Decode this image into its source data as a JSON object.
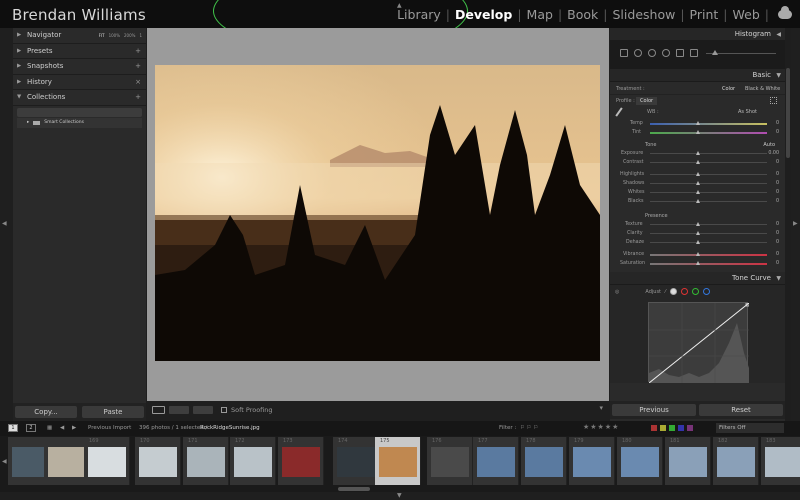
{
  "identity": "Brendan Williams",
  "modules": [
    {
      "label": "Library",
      "active": false
    },
    {
      "label": "Develop",
      "active": true
    },
    {
      "label": "Map",
      "active": false
    },
    {
      "label": "Book",
      "active": false
    },
    {
      "label": "Slideshow",
      "active": false
    },
    {
      "label": "Print",
      "active": false
    },
    {
      "label": "Web",
      "active": false
    }
  ],
  "left_panel": {
    "navigator": {
      "label": "Navigator",
      "zoom": [
        "FIT",
        "100%",
        "200%",
        "1"
      ]
    },
    "presets": {
      "label": "Presets",
      "action": "+"
    },
    "snapshots": {
      "label": "Snapshots",
      "action": "+"
    },
    "history": {
      "label": "History",
      "action": "×"
    },
    "collections": {
      "label": "Collections",
      "action": "+",
      "smart": "Smart Collections"
    },
    "copy_label": "Copy...",
    "paste_label": "Paste"
  },
  "toolbar": {
    "soft_proofing": "Soft Proofing"
  },
  "right_panel": {
    "histogram_label": "Histogram",
    "basic_label": "Basic",
    "treatment": {
      "label": "Treatment :",
      "color": "Color",
      "bw": "Black & White"
    },
    "profile": {
      "label": "Profile :",
      "value": "Color"
    },
    "wb": {
      "label": "WB :",
      "value": "As Shot"
    },
    "temp": {
      "label": "Temp",
      "value": "0"
    },
    "tint": {
      "label": "Tint",
      "value": "0"
    },
    "tone": {
      "label": "Tone",
      "auto": "Auto"
    },
    "tone_sliders": [
      {
        "label": "Exposure",
        "value": "0.00"
      },
      {
        "label": "Contrast",
        "value": "0"
      },
      {
        "label": "Highlights",
        "value": "0"
      },
      {
        "label": "Shadows",
        "value": "0"
      },
      {
        "label": "Whites",
        "value": "0"
      },
      {
        "label": "Blacks",
        "value": "0"
      }
    ],
    "presence": {
      "label": "Presence"
    },
    "presence_sliders": [
      {
        "label": "Texture",
        "value": "0"
      },
      {
        "label": "Clarity",
        "value": "0"
      },
      {
        "label": "Dehaze",
        "value": "0"
      }
    ],
    "color_sliders": [
      {
        "label": "Vibrance",
        "value": "0"
      },
      {
        "label": "Saturation",
        "value": "0"
      }
    ],
    "tone_curve_label": "Tone Curve",
    "adjust_label": "Adjust",
    "previous_label": "Previous",
    "reset_label": "Reset"
  },
  "filmbar": {
    "page1": "1",
    "page2": "2",
    "source": "Previous Import",
    "count": "396 photos / 1 selected /",
    "filename": "RockRidgeSunrise.jpg",
    "filter_label": "Filter :",
    "filters_off": "Filters Off"
  },
  "filmstrip": [
    {
      "num": "",
      "thumb": "#4a5a66"
    },
    {
      "num": "",
      "thumb": "#b8b0a0"
    },
    {
      "num": "169",
      "thumb": "#d8dde0"
    },
    {
      "num": "170",
      "thumb": "#c5ccd0"
    },
    {
      "num": "171",
      "thumb": "#aab4ba"
    },
    {
      "num": "172",
      "thumb": "#b9c2c8"
    },
    {
      "num": "173",
      "thumb": "#8a2a2a"
    },
    {
      "num": "174",
      "thumb": "#30383e"
    },
    {
      "num": "175",
      "thumb": "#c08850"
    },
    {
      "num": "176",
      "thumb": "#4a4a4a"
    },
    {
      "num": "177",
      "thumb": "#5a7aa0"
    },
    {
      "num": "178",
      "thumb": "#5a7aa0"
    },
    {
      "num": "179",
      "thumb": "#6a8ab0"
    },
    {
      "num": "180",
      "thumb": "#6a8ab0"
    },
    {
      "num": "181",
      "thumb": "#8aa0b8"
    },
    {
      "num": "182",
      "thumb": "#8aa0b8"
    },
    {
      "num": "183",
      "thumb": "#b0bcc6"
    }
  ]
}
